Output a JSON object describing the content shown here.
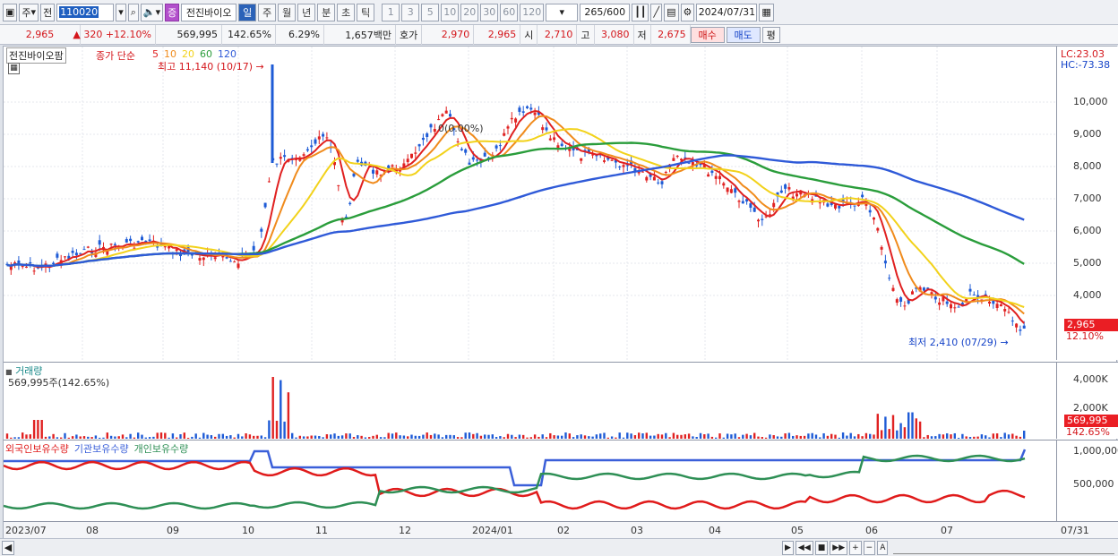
{
  "toolbar": {
    "market_label": "주",
    "type_label": "전",
    "code": "110020",
    "stock_name": "전진바이오",
    "stock_badge": "증",
    "periods": [
      "일",
      "주",
      "월",
      "년",
      "분",
      "초",
      "틱"
    ],
    "selected_period": "일",
    "intervals": [
      "1",
      "3",
      "5",
      "10",
      "20",
      "30",
      "60",
      "120"
    ],
    "count": "265",
    "count_total": "/600",
    "date": "2024/07/31"
  },
  "info": {
    "price": "2,965",
    "change": "▲ 320",
    "change_pct": "+12.10%",
    "volume": "569,995",
    "volume_ratio": "142.65%",
    "turnover": "6.29%",
    "amount": "1,657백만",
    "ask_label": "호가",
    "ask": "2,970",
    "bid": "2,965",
    "open_label": "시",
    "open": "2,710",
    "high_label": "고",
    "high": "3,080",
    "low_label": "저",
    "low": "2,675",
    "buy_label": "매수",
    "sell_label": "매도",
    "eval_label": "평"
  },
  "price_pane": {
    "tag": "전진바이오팜",
    "legend_prefix": "종가 단순",
    "ma": [
      {
        "label": "5",
        "color": "#e02020"
      },
      {
        "label": "10",
        "color": "#f08b1c"
      },
      {
        "label": "20",
        "color": "#f2d21b"
      },
      {
        "label": "60",
        "color": "#2a9d3b"
      },
      {
        "label": "120",
        "color": "#2f5ad8"
      }
    ],
    "high_note": "최고 11,140 (10/17)",
    "low_note": "최저 2,410 (07/29)",
    "mid_note": "0(0.00%)",
    "lc": "LC:23.03",
    "hc": "HC:-73.38",
    "current_price": "2,965",
    "current_pct": "12.10%",
    "y_labels": [
      "10,000",
      "9,000",
      "8,000",
      "7,000",
      "6,000",
      "5,000",
      "4,000"
    ]
  },
  "volume_pane": {
    "title": "거래량",
    "current": "569,995주(142.65%)",
    "y_labels": [
      "4,000K",
      "2,000K"
    ],
    "value_box": "569,995",
    "ratio": "142.65%"
  },
  "holding_pane": {
    "legend": [
      "외국인보유수량",
      "기관보유수량",
      "개인보유수량"
    ],
    "colors": [
      "#e01b1b",
      "#3a5fd9",
      "#2e8f55"
    ],
    "y_labels": [
      "1,000,000",
      "500,000"
    ]
  },
  "time_axis": [
    "2023/07",
    "08",
    "09",
    "10",
    "11",
    "12",
    "2024/01",
    "02",
    "03",
    "04",
    "05",
    "06",
    "07",
    "07/31"
  ],
  "bottom_controls": [
    "▶",
    "◀◀",
    "■",
    "▶▶",
    "+",
    "−",
    "A"
  ]
}
